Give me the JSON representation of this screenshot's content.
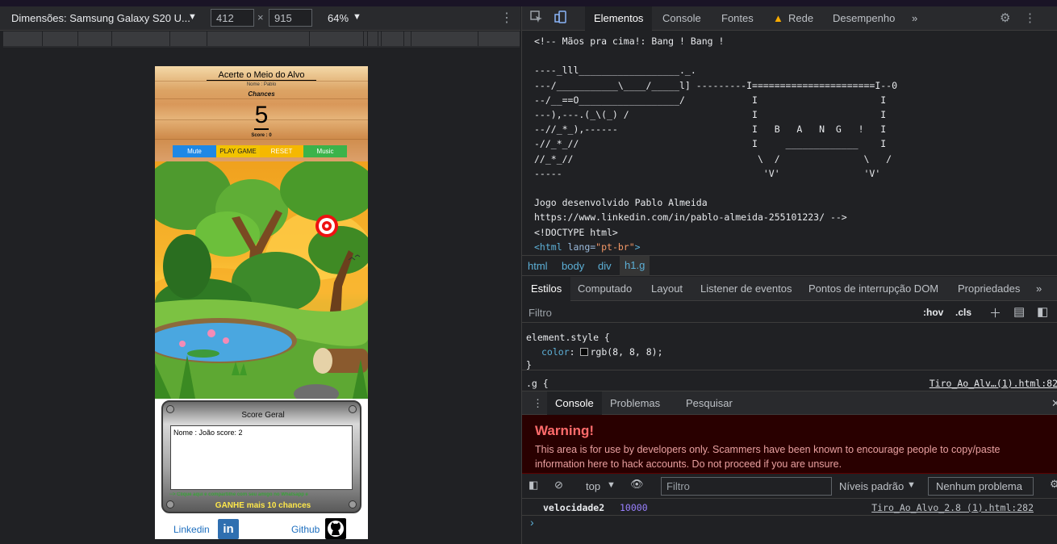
{
  "device_toolbar": {
    "device_label": "Dimensões: Samsung Galaxy S20 U...",
    "width_value": "412",
    "times": "×",
    "height_value": "915",
    "zoom": "64%",
    "more_icon": "kebab-menu-icon"
  },
  "game": {
    "title": "Acerte o Meio do Alvo",
    "nome_label": "Nome : Pablo",
    "chances_label": "Chances",
    "chances_value": "5",
    "score_label": "Score : 0",
    "buttons": {
      "mute": "Mute",
      "play": "PLAY GAME",
      "reset": "RESET",
      "music": "Music"
    },
    "score_geral_title": "Score Geral",
    "score_entry": "Nome : João score: 2",
    "share_text": "--> Clique aqui e compartilhe com seu amigo no Whatsapp e",
    "ganhe_text": "GANHE mais 10 chances",
    "linkedin_label": "Linkedin",
    "github_label": "Github",
    "linkedin_icon_text": "in"
  },
  "devtools": {
    "main_tabs": [
      "Elementos",
      "Console",
      "Fontes",
      "Rede",
      "Desempenho"
    ],
    "more_tabs": "»",
    "code_lines": [
      "<!-- Mãos pra cima!: Bang ! Bang !",
      "",
      "----_lll__________________._.",
      "---/___________\\____/_____l] ---------I======================I--0",
      "--/__==O__________________/            I                      I",
      "---),---.(_\\(_) /                      I                      I",
      "--//_*_),------                        I   B   A   N  G   !   I",
      "-//_*_//                               I     _____________    I",
      "//_*_//                                 \\  /               \\   /",
      "-----                                    'V'               'V'",
      "",
      "Jogo desenvolvido Pablo Almeida",
      "https://www.linkedin.com/in/pablo-almeida-255101223/ -->",
      "<!DOCTYPE html>"
    ],
    "html_open": {
      "tag_open": "<html",
      "attr": " lang=",
      "val": "\"pt-br\"",
      "tag_close": ">"
    },
    "breadcrumbs": [
      "html",
      "body",
      "div",
      "h1.g"
    ],
    "style_tabs": [
      "Estilos",
      "Computado",
      "Layout",
      "Listener de eventos",
      "Pontos de interrupção DOM",
      "Propriedades"
    ],
    "filter_placeholder": "Filtro",
    "hov": ":hov",
    "cls": ".cls",
    "element_style": "element.style {",
    "color_prop": "color",
    "color_value": "rgb(8, 8, 8);",
    "close_brace": "}",
    "g_selector": ".g {",
    "g_source": "Tiro_Ao_Alv…(1).html:82",
    "drawer_tabs": [
      "Console",
      "Problemas",
      "Pesquisar"
    ],
    "warning_title": "Warning!",
    "warning_message": "This area is for use by developers only. Scammers have been known to encourage people to copy/paste information here to hack accounts. Do not proceed if you are unsure.",
    "context": "top",
    "console_filter": "Filtro",
    "levels": "Níveis padrão",
    "no_problems": "Nenhum problema",
    "log_key": "velocidade2",
    "log_value": "10000",
    "log_source": "Tiro_Ao_Alvo_2.8 (1).html:282",
    "prompt_symbol": "›"
  }
}
